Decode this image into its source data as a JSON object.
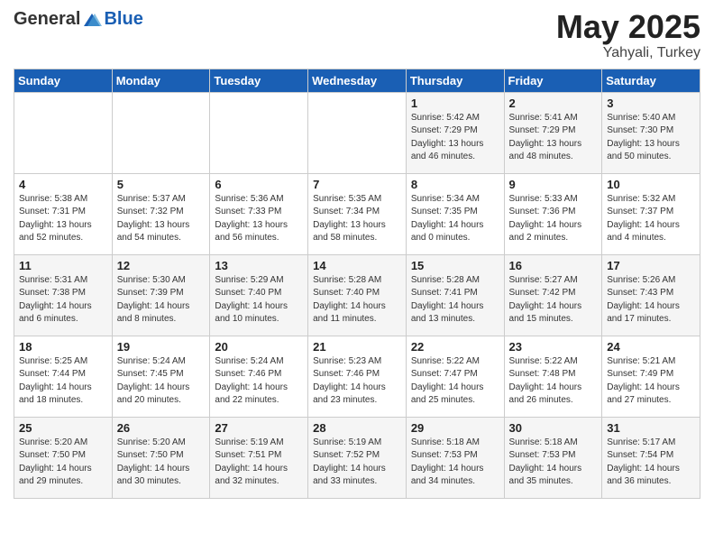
{
  "header": {
    "logo_general": "General",
    "logo_blue": "Blue",
    "title": "May 2025",
    "location": "Yahyali, Turkey"
  },
  "days_of_week": [
    "Sunday",
    "Monday",
    "Tuesday",
    "Wednesday",
    "Thursday",
    "Friday",
    "Saturday"
  ],
  "weeks": [
    [
      {
        "day": "",
        "info": ""
      },
      {
        "day": "",
        "info": ""
      },
      {
        "day": "",
        "info": ""
      },
      {
        "day": "",
        "info": ""
      },
      {
        "day": "1",
        "info": "Sunrise: 5:42 AM\nSunset: 7:29 PM\nDaylight: 13 hours\nand 46 minutes."
      },
      {
        "day": "2",
        "info": "Sunrise: 5:41 AM\nSunset: 7:29 PM\nDaylight: 13 hours\nand 48 minutes."
      },
      {
        "day": "3",
        "info": "Sunrise: 5:40 AM\nSunset: 7:30 PM\nDaylight: 13 hours\nand 50 minutes."
      }
    ],
    [
      {
        "day": "4",
        "info": "Sunrise: 5:38 AM\nSunset: 7:31 PM\nDaylight: 13 hours\nand 52 minutes."
      },
      {
        "day": "5",
        "info": "Sunrise: 5:37 AM\nSunset: 7:32 PM\nDaylight: 13 hours\nand 54 minutes."
      },
      {
        "day": "6",
        "info": "Sunrise: 5:36 AM\nSunset: 7:33 PM\nDaylight: 13 hours\nand 56 minutes."
      },
      {
        "day": "7",
        "info": "Sunrise: 5:35 AM\nSunset: 7:34 PM\nDaylight: 13 hours\nand 58 minutes."
      },
      {
        "day": "8",
        "info": "Sunrise: 5:34 AM\nSunset: 7:35 PM\nDaylight: 14 hours\nand 0 minutes."
      },
      {
        "day": "9",
        "info": "Sunrise: 5:33 AM\nSunset: 7:36 PM\nDaylight: 14 hours\nand 2 minutes."
      },
      {
        "day": "10",
        "info": "Sunrise: 5:32 AM\nSunset: 7:37 PM\nDaylight: 14 hours\nand 4 minutes."
      }
    ],
    [
      {
        "day": "11",
        "info": "Sunrise: 5:31 AM\nSunset: 7:38 PM\nDaylight: 14 hours\nand 6 minutes."
      },
      {
        "day": "12",
        "info": "Sunrise: 5:30 AM\nSunset: 7:39 PM\nDaylight: 14 hours\nand 8 minutes."
      },
      {
        "day": "13",
        "info": "Sunrise: 5:29 AM\nSunset: 7:40 PM\nDaylight: 14 hours\nand 10 minutes."
      },
      {
        "day": "14",
        "info": "Sunrise: 5:28 AM\nSunset: 7:40 PM\nDaylight: 14 hours\nand 11 minutes."
      },
      {
        "day": "15",
        "info": "Sunrise: 5:28 AM\nSunset: 7:41 PM\nDaylight: 14 hours\nand 13 minutes."
      },
      {
        "day": "16",
        "info": "Sunrise: 5:27 AM\nSunset: 7:42 PM\nDaylight: 14 hours\nand 15 minutes."
      },
      {
        "day": "17",
        "info": "Sunrise: 5:26 AM\nSunset: 7:43 PM\nDaylight: 14 hours\nand 17 minutes."
      }
    ],
    [
      {
        "day": "18",
        "info": "Sunrise: 5:25 AM\nSunset: 7:44 PM\nDaylight: 14 hours\nand 18 minutes."
      },
      {
        "day": "19",
        "info": "Sunrise: 5:24 AM\nSunset: 7:45 PM\nDaylight: 14 hours\nand 20 minutes."
      },
      {
        "day": "20",
        "info": "Sunrise: 5:24 AM\nSunset: 7:46 PM\nDaylight: 14 hours\nand 22 minutes."
      },
      {
        "day": "21",
        "info": "Sunrise: 5:23 AM\nSunset: 7:46 PM\nDaylight: 14 hours\nand 23 minutes."
      },
      {
        "day": "22",
        "info": "Sunrise: 5:22 AM\nSunset: 7:47 PM\nDaylight: 14 hours\nand 25 minutes."
      },
      {
        "day": "23",
        "info": "Sunrise: 5:22 AM\nSunset: 7:48 PM\nDaylight: 14 hours\nand 26 minutes."
      },
      {
        "day": "24",
        "info": "Sunrise: 5:21 AM\nSunset: 7:49 PM\nDaylight: 14 hours\nand 27 minutes."
      }
    ],
    [
      {
        "day": "25",
        "info": "Sunrise: 5:20 AM\nSunset: 7:50 PM\nDaylight: 14 hours\nand 29 minutes."
      },
      {
        "day": "26",
        "info": "Sunrise: 5:20 AM\nSunset: 7:50 PM\nDaylight: 14 hours\nand 30 minutes."
      },
      {
        "day": "27",
        "info": "Sunrise: 5:19 AM\nSunset: 7:51 PM\nDaylight: 14 hours\nand 32 minutes."
      },
      {
        "day": "28",
        "info": "Sunrise: 5:19 AM\nSunset: 7:52 PM\nDaylight: 14 hours\nand 33 minutes."
      },
      {
        "day": "29",
        "info": "Sunrise: 5:18 AM\nSunset: 7:53 PM\nDaylight: 14 hours\nand 34 minutes."
      },
      {
        "day": "30",
        "info": "Sunrise: 5:18 AM\nSunset: 7:53 PM\nDaylight: 14 hours\nand 35 minutes."
      },
      {
        "day": "31",
        "info": "Sunrise: 5:17 AM\nSunset: 7:54 PM\nDaylight: 14 hours\nand 36 minutes."
      }
    ]
  ]
}
